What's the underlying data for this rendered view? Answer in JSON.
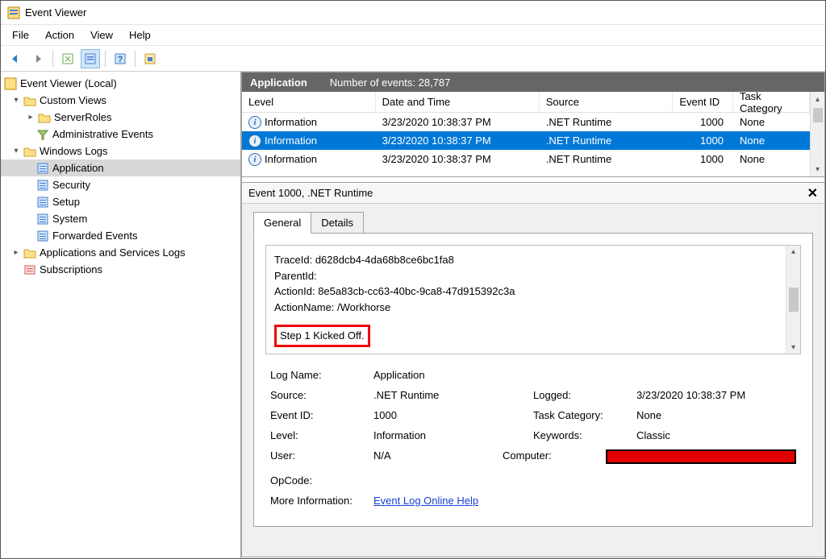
{
  "titlebar": {
    "title": "Event Viewer"
  },
  "menu": {
    "file": "File",
    "action": "Action",
    "view": "View",
    "help": "Help"
  },
  "tree": {
    "root": "Event Viewer (Local)",
    "customViews": "Custom Views",
    "serverRoles": "ServerRoles",
    "adminEvents": "Administrative Events",
    "winLogs": "Windows Logs",
    "application": "Application",
    "security": "Security",
    "setup": "Setup",
    "system": "System",
    "forwarded": "Forwarded Events",
    "appsSvc": "Applications and Services Logs",
    "subs": "Subscriptions"
  },
  "header": {
    "title": "Application",
    "count_label": "Number of events: 28,787"
  },
  "grid": {
    "cols": {
      "level": "Level",
      "date": "Date and Time",
      "source": "Source",
      "id": "Event ID",
      "cat": "Task Category"
    },
    "rows": [
      {
        "level": "Information",
        "date": "3/23/2020 10:38:37 PM",
        "source": ".NET Runtime",
        "id": "1000",
        "cat": "None"
      },
      {
        "level": "Information",
        "date": "3/23/2020 10:38:37 PM",
        "source": ".NET Runtime",
        "id": "1000",
        "cat": "None"
      },
      {
        "level": "Information",
        "date": "3/23/2020 10:38:37 PM",
        "source": ".NET Runtime",
        "id": "1000",
        "cat": "None"
      }
    ]
  },
  "detail": {
    "title": "Event 1000, .NET Runtime",
    "tabs": {
      "general": "General",
      "details": "Details"
    },
    "msg": {
      "l1": "TraceId: d628dcb4-4da68b8ce6bc1fa8",
      "l2": "ParentId:",
      "l3": "ActionId: 8e5a83cb-cc63-40bc-9ca8-47d915392c3a",
      "l4": "ActionName: /Workhorse",
      "l5": "Step 1 Kicked Off."
    },
    "props": {
      "logname_l": "Log Name:",
      "logname_v": "Application",
      "source_l": "Source:",
      "source_v": ".NET Runtime",
      "logged_l": "Logged:",
      "logged_v": "3/23/2020 10:38:37 PM",
      "eventid_l": "Event ID:",
      "eventid_v": "1000",
      "taskcat_l": "Task Category:",
      "taskcat_v": "None",
      "level_l": "Level:",
      "level_v": "Information",
      "keywords_l": "Keywords:",
      "keywords_v": "Classic",
      "user_l": "User:",
      "user_v": "N/A",
      "computer_l": "Computer:",
      "opcode_l": "OpCode:",
      "moreinfo_l": "More Information:",
      "moreinfo_v": "Event Log Online Help"
    }
  }
}
